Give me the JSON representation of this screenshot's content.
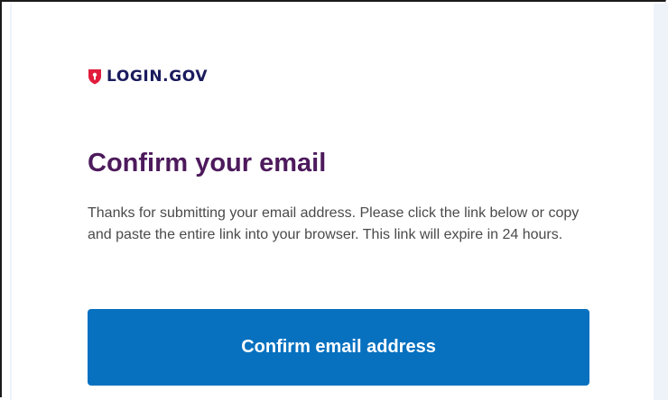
{
  "brand": {
    "logo_icon": "shield-lock-icon",
    "logo_text": "LOGIN.GOV",
    "accent_color": "#e21c3d"
  },
  "email": {
    "title": "Confirm your email",
    "title_color": "#4d1a5c",
    "body": "Thanks for submitting your email address. Please click the link below or copy and paste the entire link into your browser. This link will expire in 24 hours.",
    "cta_label": "Confirm email address",
    "cta_color": "#0771c0"
  }
}
